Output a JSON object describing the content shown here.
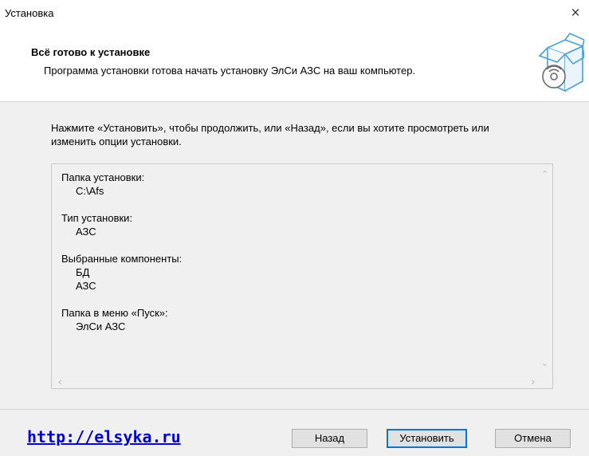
{
  "window": {
    "title": "Установка",
    "close_symbol": "×"
  },
  "header": {
    "title": "Всё готово к установке",
    "subtitle": "Программа установки готова начать установку ЭлСи АЗС на ваш компьютер.",
    "icon": "installer-box-disc-icon"
  },
  "instruction": "Нажмите «Установить», чтобы продолжить, или «Назад», если вы хотите просмотреть или изменить опции установки.",
  "memo": {
    "groups": [
      {
        "label": "Папка установки:",
        "values": [
          "C:\\Afs"
        ]
      },
      {
        "label": "Тип установки:",
        "values": [
          "АЗС"
        ]
      },
      {
        "label": "Выбранные компоненты:",
        "values": [
          "БД",
          "АЗС"
        ]
      },
      {
        "label": "Папка в меню «Пуск»:",
        "values": [
          "ЭлСи АЗС"
        ]
      }
    ],
    "scroll_up": "⌃",
    "scroll_down": "⌄",
    "scroll_left": "‹",
    "scroll_right": "›"
  },
  "footer": {
    "link": "http://elsyka.ru",
    "back_label": "Назад",
    "install_label": "Установить",
    "cancel_label": "Отмена"
  },
  "colors": {
    "link": "#0000cc",
    "focus_border": "#0078d7"
  }
}
